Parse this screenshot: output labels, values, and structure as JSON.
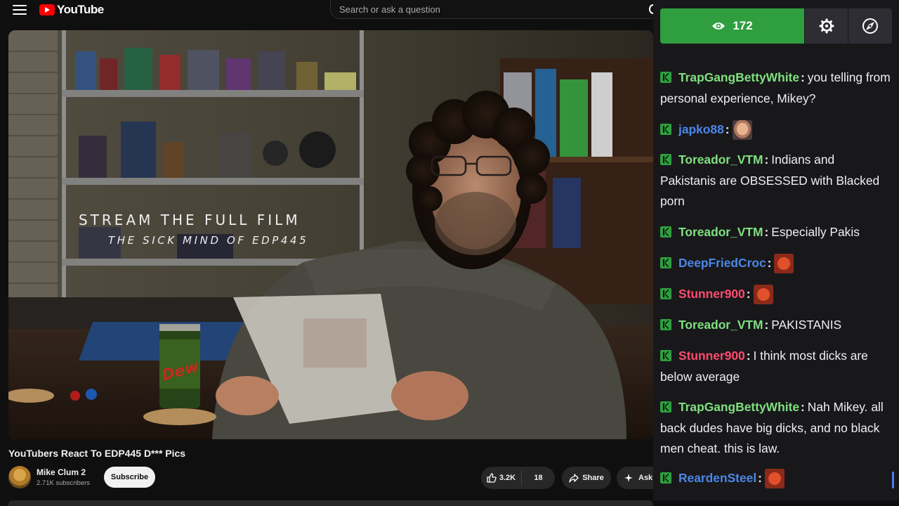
{
  "header": {
    "menu_icon": "hamburger-menu-icon",
    "logo_text": "YouTube",
    "search_placeholder": "Search or ask a question"
  },
  "player": {
    "overlay_line1": "STREAM THE FULL FILM",
    "overlay_line2": "THE SICK MIND OF EDP445"
  },
  "video": {
    "title": "YouTubers React To EDP445 D*** Pics",
    "channel_name": "Mike Clum 2",
    "subscribers": "2.71K subscribers",
    "subscribe_label": "Subscribe",
    "likes": "3.2K",
    "dislikes": "18",
    "share_label": "Share",
    "ask_label": "Ask"
  },
  "chat": {
    "viewer_count": "172",
    "colors": {
      "green": "#7fe07f",
      "blue": "#4c86e8",
      "red": "#ff4b6e",
      "badge": "#2e9e3f",
      "viewer_button": "#2e9e3f"
    },
    "messages": [
      {
        "user": "TrapGangBettyWhite",
        "text": "you telling from personal experience, Mikey?",
        "emote": ""
      },
      {
        "user": "japko88",
        "text": "",
        "emote": "face-emote"
      },
      {
        "user": "Toreador_VTM",
        "text": "Indians and Pakistanis are OBSESSED with Blacked porn",
        "emote": ""
      },
      {
        "user": "Toreador_VTM",
        "text": "Especially Pakis",
        "emote": ""
      },
      {
        "user": "DeepFriedCroc",
        "text": "",
        "emote": "face-emote"
      },
      {
        "user": "Stunner900",
        "text": "",
        "emote": "face-emote"
      },
      {
        "user": "Toreador_VTM",
        "text": "PAKISTANIS",
        "emote": ""
      },
      {
        "user": "Stunner900",
        "text": "I think most dicks are below average",
        "emote": ""
      },
      {
        "user": "TrapGangBettyWhite",
        "text": "Nah Mikey. all back dudes have big dicks, and no black men cheat. this is law.",
        "emote": ""
      },
      {
        "user": "ReardenSteel",
        "text": "",
        "emote": "face-emote"
      }
    ]
  }
}
